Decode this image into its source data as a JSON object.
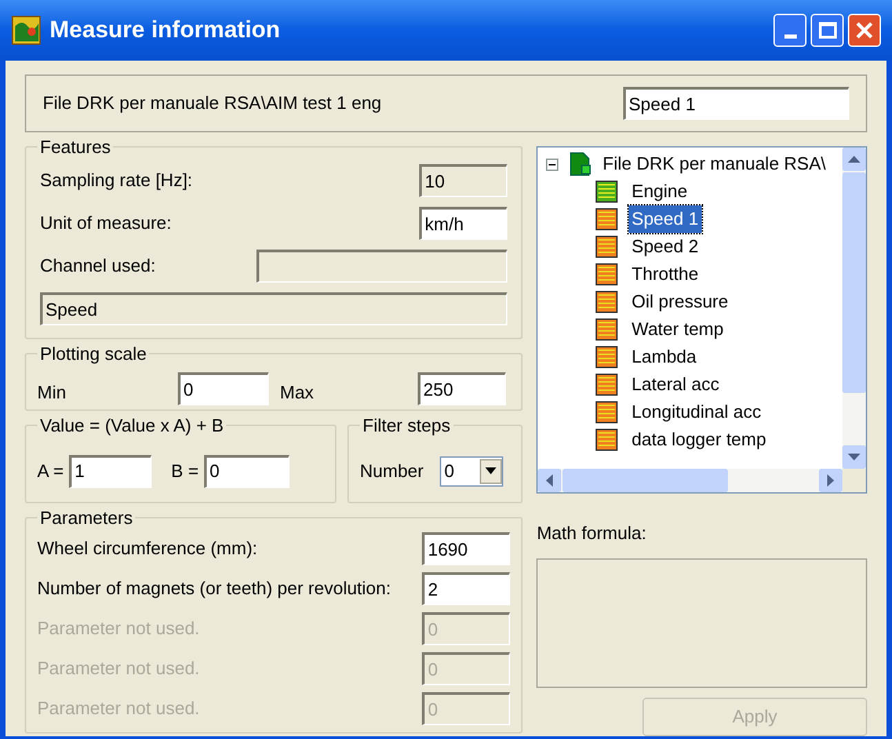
{
  "window": {
    "title": "Measure information"
  },
  "header": {
    "file": "File DRK per manuale RSA\\AIM test 1 eng",
    "name_value": "Speed 1"
  },
  "features": {
    "title": "Features",
    "sampling_label": "Sampling rate [Hz]:",
    "sampling_value": "10",
    "unit_label": "Unit of measure:",
    "unit_value": "km/h",
    "channel_label": "Channel used:",
    "type_value": "Speed"
  },
  "plotting_scale": {
    "title": "Plotting scale",
    "min_label": "Min",
    "min_value": "0",
    "max_label": "Max",
    "max_value": "250"
  },
  "formula_group": {
    "title": "Value = (Value x A) + B",
    "a_label": "A =",
    "a_value": "1",
    "b_label": "B =",
    "b_value": "0"
  },
  "filter_steps": {
    "title": "Filter steps",
    "label": "Number",
    "value": "0"
  },
  "parameters": {
    "title": "Parameters",
    "rows": [
      {
        "label": "Wheel circumference (mm):",
        "value": "1690",
        "disabled": false
      },
      {
        "label": "Number of magnets (or teeth) per revolution:",
        "value": "2",
        "disabled": false
      },
      {
        "label": "Parameter not used.",
        "value": "0",
        "disabled": true
      },
      {
        "label": "Parameter not used.",
        "value": "0",
        "disabled": true
      },
      {
        "label": "Parameter not used.",
        "value": "0",
        "disabled": true
      }
    ]
  },
  "tree": {
    "root": "File DRK per manuale RSA\\",
    "expanded": true,
    "children": [
      {
        "label": "Engine",
        "color": "#4caf20",
        "selected": false
      },
      {
        "label": "Speed 1",
        "color": "#f08020",
        "selected": true
      },
      {
        "label": "Speed 2",
        "color": "#f08020",
        "selected": false
      },
      {
        "label": "Throtthe",
        "color": "#f08020",
        "selected": false
      },
      {
        "label": "Oil pressure",
        "color": "#f08020",
        "selected": false
      },
      {
        "label": "Water temp",
        "color": "#f08020",
        "selected": false
      },
      {
        "label": "Lambda",
        "color": "#f08020",
        "selected": false
      },
      {
        "label": "Lateral acc",
        "color": "#f08020",
        "selected": false
      },
      {
        "label": "Longitudinal acc",
        "color": "#f08020",
        "selected": false
      },
      {
        "label": "data logger temp",
        "color": "#f08020",
        "selected": false
      }
    ]
  },
  "math_formula": {
    "label": "Math formula:"
  },
  "apply_button": {
    "label": "Apply",
    "disabled": true
  }
}
